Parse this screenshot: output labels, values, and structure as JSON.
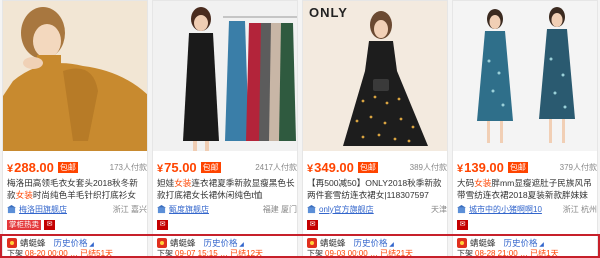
{
  "products": [
    {
      "price": "288.00",
      "postage_label": "包邮",
      "sold": "173人付款",
      "title_before": "梅洛田高领毛衣女套头2018秋冬新款",
      "title_hl": "女装",
      "title_after": "时尚纯色羊毛针织打底衫女",
      "shop": "梅洛田旗舰店",
      "location": "浙江 嘉兴",
      "badges": [
        "掌柜热卖"
      ],
      "plugin_name": "蜻蜓蜂",
      "plugin_history": "历史价格",
      "plugin_line": "下架",
      "plugin_time": "08-20 00:00 … 已结51天",
      "photo_bg": "#efe4d6",
      "garment": "#c88a2f"
    },
    {
      "price": "75.00",
      "postage_label": "包邮",
      "sold": "2417人付款",
      "title_before": "妲娃",
      "title_hl": "女装",
      "title_after": "连衣裙夏季新款显瘦黑色长款打底裙女长裙休闲纯色t恤",
      "shop": "甄度旗舰店",
      "location": "福建 厦门",
      "badges": [],
      "plugin_name": "蜻蜓蜂",
      "plugin_history": "历史价格",
      "plugin_line": "下架",
      "plugin_time": "09-07 15:15 … 已结12天",
      "photo_bg": "#f1f1f1",
      "garment": "#1a1a1a"
    },
    {
      "brand_logo": "ONLY",
      "price": "349.00",
      "postage_label": "包邮",
      "sold": "389人付款",
      "title_before": "【再500减50】ONLY2018秋季新款两件套雪纺连衣裙女|118307597",
      "title_hl": "",
      "title_after": "",
      "shop": "only官方旗舰店",
      "location": "天津",
      "badges": [],
      "plugin_name": "蜻蜓蜂",
      "plugin_history": "历史价格",
      "plugin_line": "下架",
      "plugin_time": "09-03 00:00 … 已结21天",
      "photo_bg": "#f3eadf",
      "garment": "#1d1d1d"
    },
    {
      "price": "139.00",
      "postage_label": "包邮",
      "sold": "379人付款",
      "title_before": "大码",
      "title_hl": "女装",
      "title_after": "胖mm显瘦遮肚子民族风吊带雪纺连衣裙2018夏装新款胖妹妹",
      "shop": "城市中的小猪啊啊10",
      "location": "浙江 杭州",
      "badges": [],
      "plugin_name": "蜻蜓蜂",
      "plugin_history": "历史价格",
      "plugin_line": "下架",
      "plugin_time": "08-28 21:00 … 已结1天",
      "photo_bg": "#f4f4f4",
      "garment": "#2f6f8a"
    }
  ]
}
